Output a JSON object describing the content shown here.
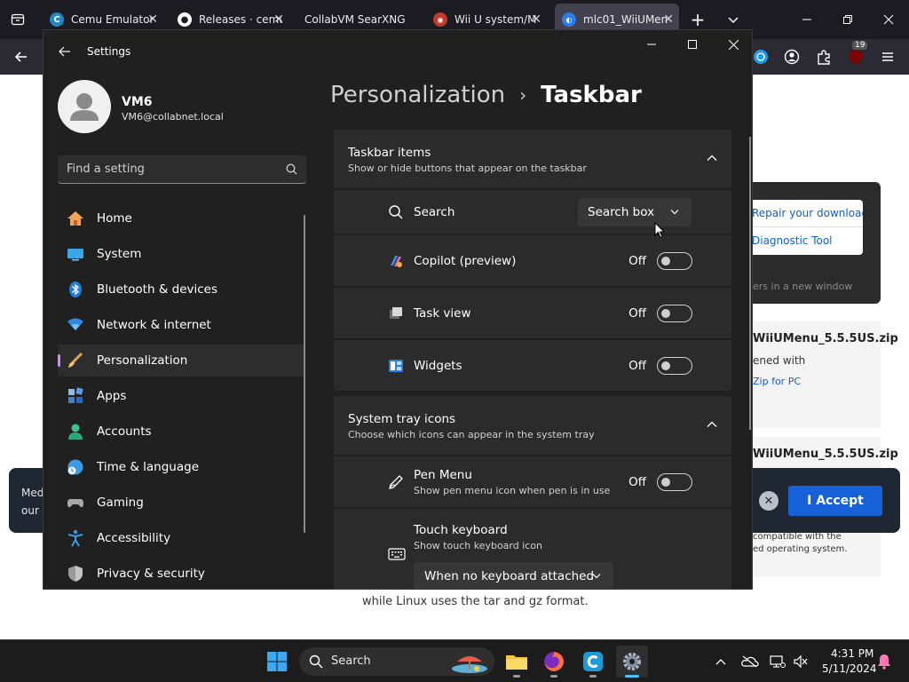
{
  "browser": {
    "tabs": [
      {
        "label": "Cemu Emulator",
        "icon": "cemu-icon"
      },
      {
        "label": "Releases · cemu",
        "icon": "github-icon"
      },
      {
        "label": "CollabVM SearXNG",
        "icon": "none"
      },
      {
        "label": "Wii U system/M",
        "icon": "searx-icon"
      },
      {
        "label": "mlc01_WiiUMen",
        "icon": "edge-icon"
      }
    ],
    "extension_badge": "19"
  },
  "webpage": {
    "popup_item_1": "Repair your download",
    "popup_item_2": "Diagnostic Tool",
    "popup_footer": "ers in a new window",
    "card1_filename": "WiiUMenu_5.5.5US.zip",
    "card1_sub": "ened with",
    "card1_link": "Zip for PC",
    "card2_filename": "WiiUMenu_5.5.5US.zip",
    "compat_line1": "compatible with the",
    "compat_line2": "ed operating system.",
    "bottom_text": "while Linux uses the tar and gz format."
  },
  "cookie_banner": {
    "text_line1": "Med",
    "text_line2": "our",
    "accept_label": "I Accept"
  },
  "settings": {
    "window_title": "Settings",
    "profile": {
      "name": "VM6",
      "email": "VM6@collabnet.local"
    },
    "search_placeholder": "Find a setting",
    "nav": [
      {
        "label": "Home",
        "icon": "home-icon"
      },
      {
        "label": "System",
        "icon": "system-icon"
      },
      {
        "label": "Bluetooth & devices",
        "icon": "bluetooth-icon"
      },
      {
        "label": "Network & internet",
        "icon": "wifi-icon"
      },
      {
        "label": "Personalization",
        "icon": "brush-icon",
        "selected": true
      },
      {
        "label": "Apps",
        "icon": "apps-icon"
      },
      {
        "label": "Accounts",
        "icon": "accounts-icon"
      },
      {
        "label": "Time & language",
        "icon": "globe-clock-icon"
      },
      {
        "label": "Gaming",
        "icon": "gamepad-icon"
      },
      {
        "label": "Accessibility",
        "icon": "accessibility-icon"
      },
      {
        "label": "Privacy & security",
        "icon": "shield-icon"
      }
    ],
    "breadcrumb": {
      "parent": "Personalization",
      "separator": "›",
      "current": "Taskbar"
    },
    "taskbar_items": {
      "title": "Taskbar items",
      "subtitle": "Show or hide buttons that appear on the taskbar",
      "search": {
        "label": "Search",
        "value": "Search box"
      },
      "copilot": {
        "label": "Copilot (preview)",
        "state": "Off"
      },
      "task_view": {
        "label": "Task view",
        "state": "Off"
      },
      "widgets": {
        "label": "Widgets",
        "state": "Off"
      }
    },
    "system_tray": {
      "title": "System tray icons",
      "subtitle": "Choose which icons can appear in the system tray",
      "pen_menu": {
        "label": "Pen Menu",
        "sub": "Show pen menu icon when pen is in use",
        "state": "Off"
      },
      "touch_keyboard": {
        "label": "Touch keyboard",
        "sub": "Show touch keyboard icon",
        "value": "When no keyboard attached"
      }
    }
  },
  "taskbar": {
    "search_label": "Search",
    "time": "4:31 PM",
    "date": "5/11/2024"
  },
  "colors": {
    "accent": "#ca89ff",
    "toggle_off": "#cfcfcf",
    "accept_blue": "#1660d8"
  }
}
